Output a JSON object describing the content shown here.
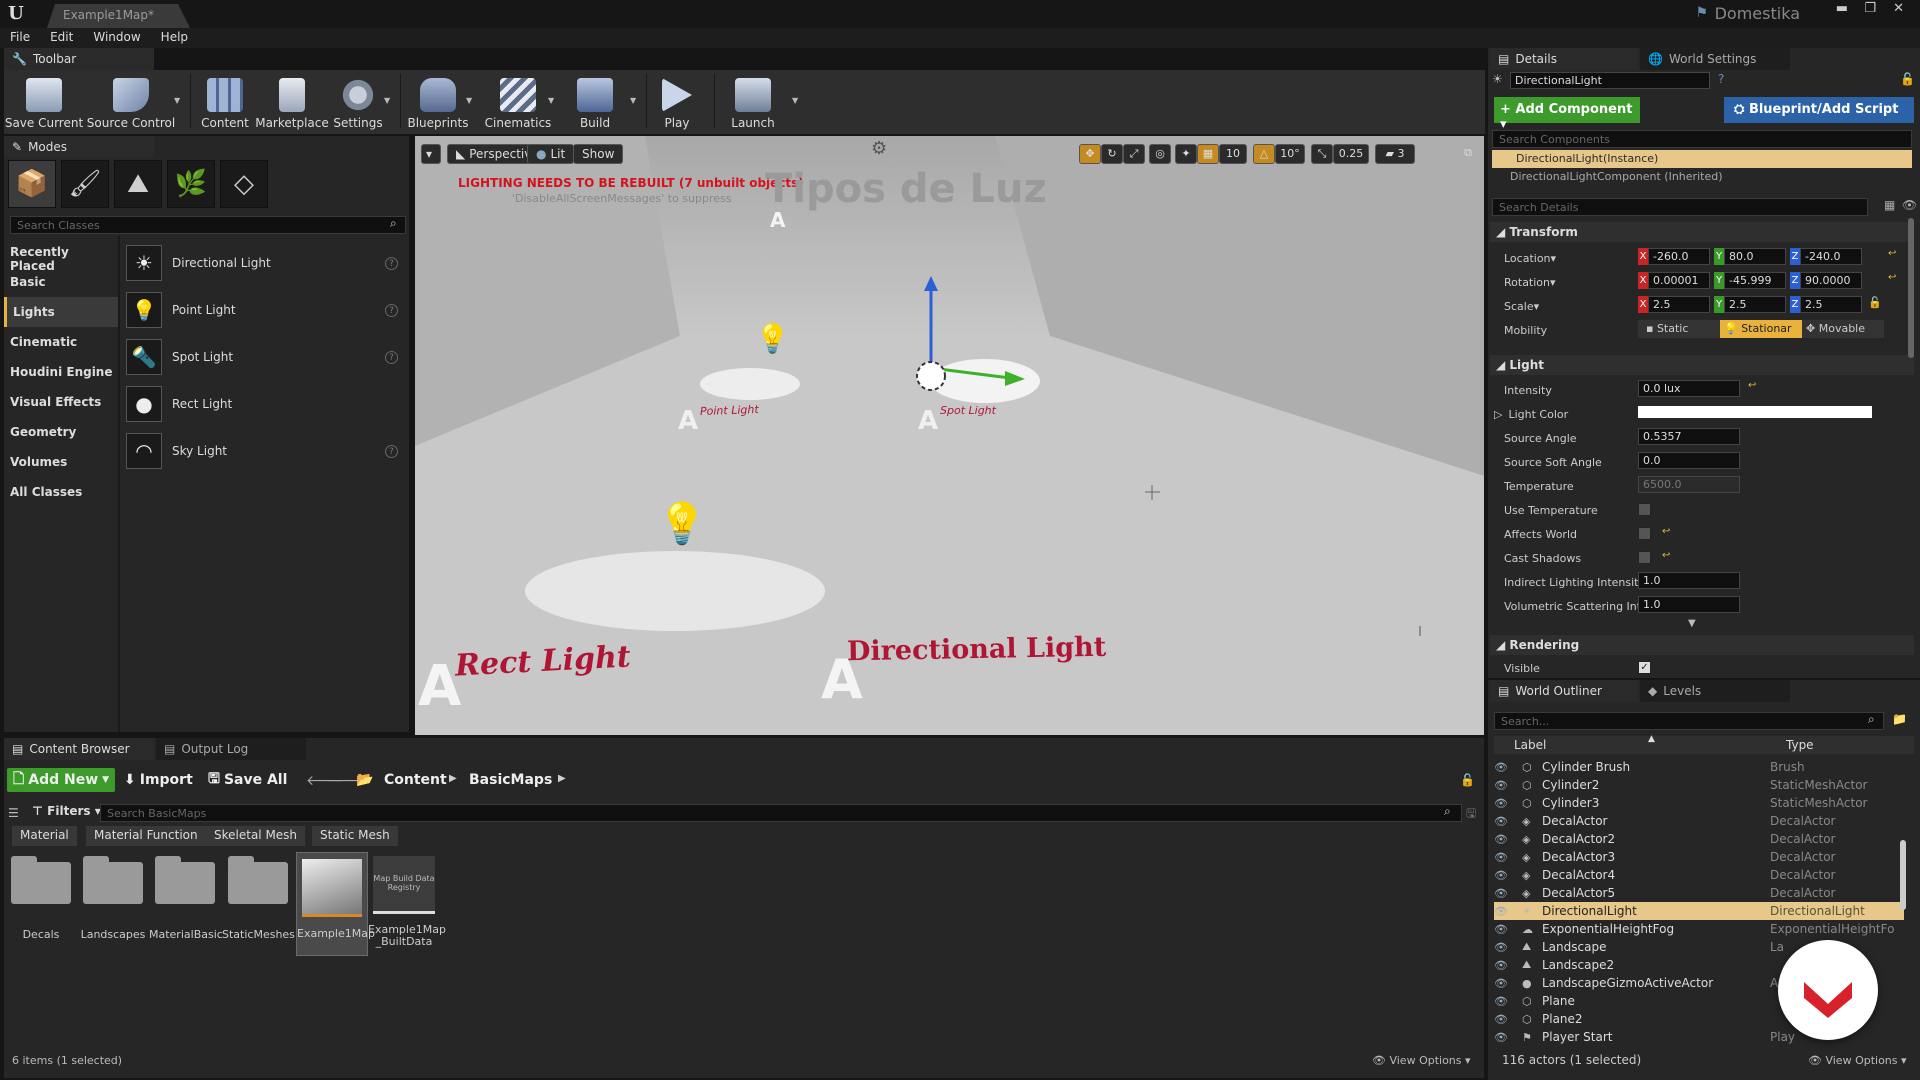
{
  "window": {
    "doc_tab": "Example1Map*",
    "brand": "Domestika"
  },
  "menu": [
    "File",
    "Edit",
    "Window",
    "Help"
  ],
  "toolbar": {
    "tab": "Toolbar",
    "buttons": [
      "Save Current",
      "Source Control",
      "Content",
      "Marketplace",
      "Settings",
      "Blueprints",
      "Cinematics",
      "Build",
      "Play",
      "Launch"
    ]
  },
  "modes": {
    "tab": "Modes",
    "search_placeholder": "Search Classes",
    "categories": [
      "Recently Placed",
      "Basic",
      "Lights",
      "Cinematic",
      "Houdini Engine",
      "Visual Effects",
      "Geometry",
      "Volumes",
      "All Classes"
    ],
    "selected_category": "Lights",
    "items": [
      "Directional Light",
      "Point Light",
      "Spot Light",
      "Rect Light",
      "Sky Light"
    ]
  },
  "viewport": {
    "perspective": "Perspective",
    "lit": "Lit",
    "show": "Show",
    "grid": "10",
    "angle": "10°",
    "scale": "0.25",
    "camspeed": "3",
    "warning": "LIGHTING NEEDS TO BE REBUILT (7 unbuilt objects)",
    "suppress": "'DisableAllScreenMessages' to suppress",
    "scene_title": "Tipos de Luz",
    "labels": {
      "point": "Point Light",
      "spot": "Spot Light",
      "rect": "Rect Light",
      "directional": "Directional Light"
    }
  },
  "content_browser": {
    "tab": "Content Browser",
    "tab2": "Output Log",
    "add_new": "Add New",
    "import": "Import",
    "save_all": "Save All",
    "path": [
      "Content",
      "BasicMaps"
    ],
    "filters": "Filters",
    "search_placeholder": "Search BasicMaps",
    "filter_tags": [
      "Material",
      "Material Function",
      "Skeletal Mesh",
      "Static Mesh"
    ],
    "assets": [
      "Decals",
      "Landscapes",
      "MaterialBasic",
      "StaticMeshes",
      "Example1Map",
      "Example1Map\n_BuiltData"
    ],
    "registry_label": "Map Build Data Registry",
    "status": "6 items (1 selected)",
    "view_options": "View Options"
  },
  "details": {
    "tab": "Details",
    "tab2": "World Settings",
    "name": "DirectionalLight",
    "add_component": "+ Add Component",
    "blueprint": "Blueprint/Add Script",
    "search_components": "Search Components",
    "instance": "DirectionalLight(Instance)",
    "component": "DirectionalLightComponent (Inherited)",
    "search_details": "Search Details",
    "transform": "Transform",
    "location": {
      "label": "Location",
      "x": "-260.0",
      "y": "80.0",
      "z": "-240.0"
    },
    "rotation": {
      "label": "Rotation",
      "x": "0.00001",
      "y": "-45.999",
      "z": "90.0000"
    },
    "scale": {
      "label": "Scale",
      "x": "2.5",
      "y": "2.5",
      "z": "2.5"
    },
    "mobility": {
      "label": "Mobility",
      "static": "Static",
      "stationary": "Stationar",
      "movable": "Movable"
    },
    "light": "Light",
    "intensity": {
      "label": "Intensity",
      "value": "0.0 lux"
    },
    "light_color": "Light Color",
    "source_angle": {
      "label": "Source Angle",
      "value": "0.5357"
    },
    "source_soft_angle": {
      "label": "Source Soft Angle",
      "value": "0.0"
    },
    "temperature": {
      "label": "Temperature",
      "value": "6500.0"
    },
    "use_temperature": "Use Temperature",
    "affects_world": "Affects World",
    "cast_shadows": "Cast Shadows",
    "indirect": {
      "label": "Indirect Lighting Intensity",
      "value": "1.0"
    },
    "volumetric": {
      "label": "Volumetric Scattering Inte",
      "value": "1.0"
    },
    "rendering": "Rendering",
    "visible": "Visible"
  },
  "outliner": {
    "tab": "World Outliner",
    "tab2": "Levels",
    "search_placeholder": "Search...",
    "col_label": "Label",
    "col_type": "Type",
    "rows": [
      {
        "label": "Cylinder Brush",
        "type": "Brush"
      },
      {
        "label": "Cylinder2",
        "type": "StaticMeshActor"
      },
      {
        "label": "Cylinder3",
        "type": "StaticMeshActor"
      },
      {
        "label": "DecalActor",
        "type": "DecalActor"
      },
      {
        "label": "DecalActor2",
        "type": "DecalActor"
      },
      {
        "label": "DecalActor3",
        "type": "DecalActor"
      },
      {
        "label": "DecalActor4",
        "type": "DecalActor"
      },
      {
        "label": "DecalActor5",
        "type": "DecalActor"
      },
      {
        "label": "DirectionalLight",
        "type": "DirectionalLight"
      },
      {
        "label": "ExponentialHeightFog",
        "type": "ExponentialHeightFo"
      },
      {
        "label": "Landscape",
        "type": "La"
      },
      {
        "label": "Landscape2",
        "type": ""
      },
      {
        "label": "LandscapeGizmoActiveActor",
        "type": "Act"
      },
      {
        "label": "Plane",
        "type": ""
      },
      {
        "label": "Plane2",
        "type": ""
      },
      {
        "label": "Player Start",
        "type": "Play"
      }
    ],
    "selected_index": 8,
    "status": "116 actors (1 selected)",
    "view_options": "View Options"
  },
  "colors": {
    "accent": "#e8b23c",
    "add_green": "#3c9b2a",
    "blueprint_blue": "#2b62a8",
    "selection": "#e8c88a",
    "brand_red": "#d8222b"
  }
}
